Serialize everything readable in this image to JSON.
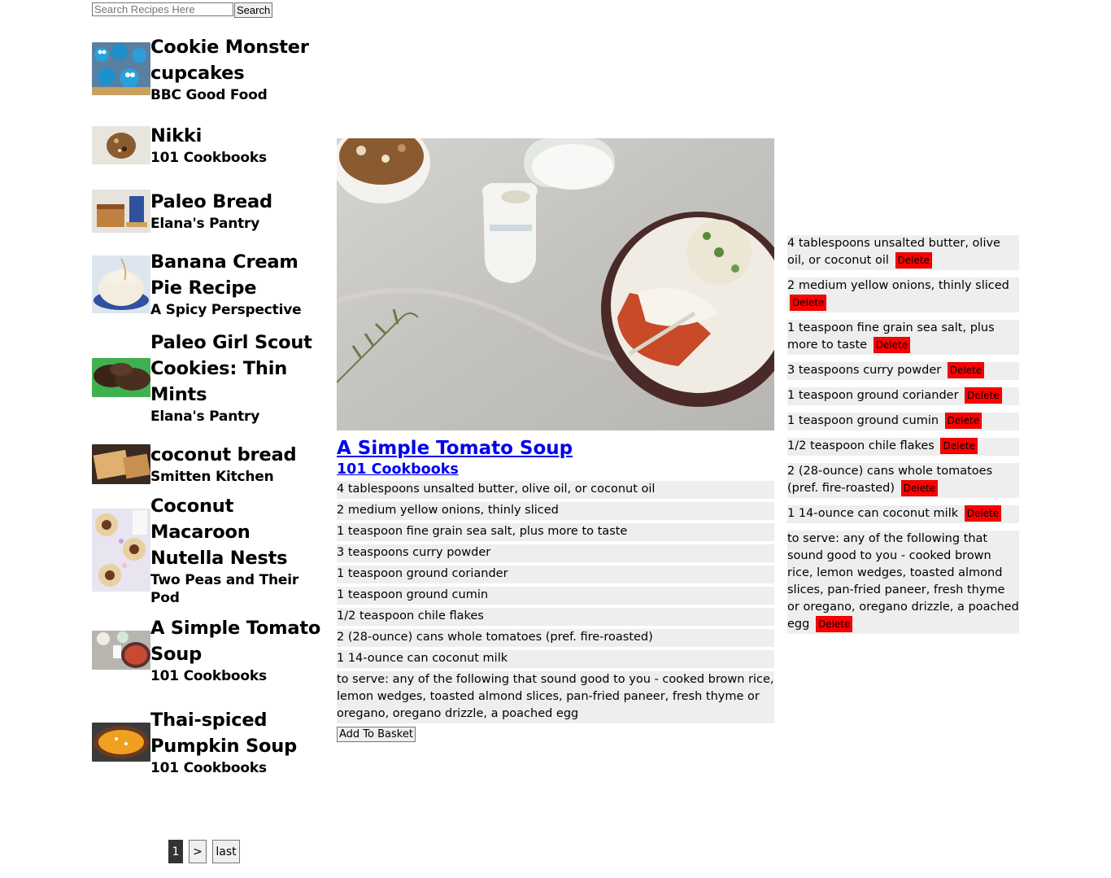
{
  "search": {
    "placeholder": "Search Recipes Here",
    "value": "",
    "button_label": "Search"
  },
  "recipes": [
    {
      "title": "Cookie Monster cupcakes",
      "source": "BBC Good Food"
    },
    {
      "title": "Nikki",
      "source": "101 Cookbooks"
    },
    {
      "title": "Paleo Bread",
      "source": "Elana's Pantry"
    },
    {
      "title": "Banana Cream Pie Recipe",
      "source": "A Spicy Perspective"
    },
    {
      "title": "Paleo Girl Scout Cookies: Thin Mints",
      "source": "Elana's Pantry"
    },
    {
      "title": "coconut bread",
      "source": "Smitten Kitchen"
    },
    {
      "title": "Coconut Macaroon Nutella Nests",
      "source": "Two Peas and Their Pod"
    },
    {
      "title": "A Simple Tomato Soup",
      "source": "101 Cookbooks"
    },
    {
      "title": "Thai-spiced Pumpkin Soup",
      "source": "101 Cookbooks"
    }
  ],
  "pagination": {
    "current": "1",
    "next": ">",
    "last": "last"
  },
  "detail": {
    "title": "A Simple Tomato Soup",
    "source": "101 Cookbooks",
    "ingredients": [
      "4 tablespoons unsalted butter, olive oil, or coconut oil",
      "2 medium yellow onions, thinly sliced",
      "1 teaspoon fine grain sea salt, plus more to taste",
      "3 teaspoons curry powder",
      "1 teaspoon ground coriander",
      "1 teaspoon ground cumin",
      "1/2 teaspoon chile flakes",
      "2 (28-ounce) cans whole tomatoes (pref. fire-roasted)",
      "1 14-ounce can coconut milk",
      "to serve: any of the following that sound good to you - cooked brown rice, lemon wedges, toasted almond slices, pan-fried paneer, fresh thyme or oregano, oregano drizzle, a poached egg"
    ],
    "add_button_label": "Add To Basket"
  },
  "basket": {
    "delete_label": "Delete",
    "items": [
      "4 tablespoons unsalted butter, olive oil, or coconut oil",
      "2 medium yellow onions, thinly sliced",
      "1 teaspoon fine grain sea salt, plus more to taste",
      "3 teaspoons curry powder",
      "1 teaspoon ground coriander",
      "1 teaspoon ground cumin",
      "1/2 teaspoon chile flakes",
      "2 (28-ounce) cans whole tomatoes (pref. fire-roasted)",
      "1 14-ounce can coconut milk",
      "to serve: any of the following that sound good to you - cooked brown rice, lemon wedges, toasted almond slices, pan-fried paneer, fresh thyme or oregano, oregano drizzle, a poached egg"
    ]
  },
  "colors": {
    "link": "#0000ee",
    "delete_bg": "#ff0000",
    "item_bg": "#eeeeee",
    "active_page_bg": "#333333"
  }
}
